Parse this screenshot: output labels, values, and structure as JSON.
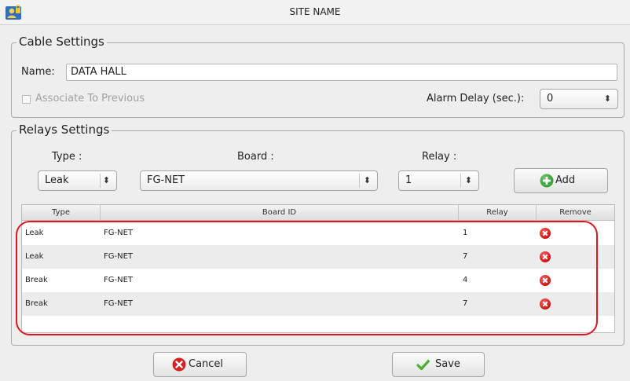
{
  "window": {
    "title": "SITE NAME",
    "app_icon": "user-lock-icon"
  },
  "cable_settings": {
    "group_title": "Cable Settings",
    "name_label": "Name:",
    "name_value": "DATA HALL",
    "associate_label": "Associate To Previous",
    "associate_checked": false,
    "alarm_delay_label": "Alarm Delay (sec.):",
    "alarm_delay_value": "0"
  },
  "relays_settings": {
    "group_title": "Relays Settings",
    "type_label": "Type :",
    "board_label": "Board :",
    "relay_label": "Relay :",
    "type_value": "Leak",
    "board_value": "FG-NET",
    "relay_value": "1",
    "add_label": "Add",
    "add_icon": "plus-circle-icon"
  },
  "table": {
    "columns": [
      "Type",
      "Board ID",
      "Relay",
      "Remove"
    ],
    "rows": [
      {
        "type": "Leak",
        "board_id": "FG-NET",
        "relay": "1"
      },
      {
        "type": "Leak",
        "board_id": "FG-NET",
        "relay": "7"
      },
      {
        "type": "Break",
        "board_id": "FG-NET",
        "relay": "4"
      },
      {
        "type": "Break",
        "board_id": "FG-NET",
        "relay": "7"
      }
    ],
    "remove_icon": "remove-circle-icon"
  },
  "footer": {
    "cancel_label": "Cancel",
    "cancel_icon": "cancel-circle-icon",
    "save_label": "Save",
    "save_icon": "checkmark-icon"
  },
  "colors": {
    "highlight": "#e0161b",
    "add_green": "#3aa83a",
    "remove_red": "#cc1111"
  }
}
